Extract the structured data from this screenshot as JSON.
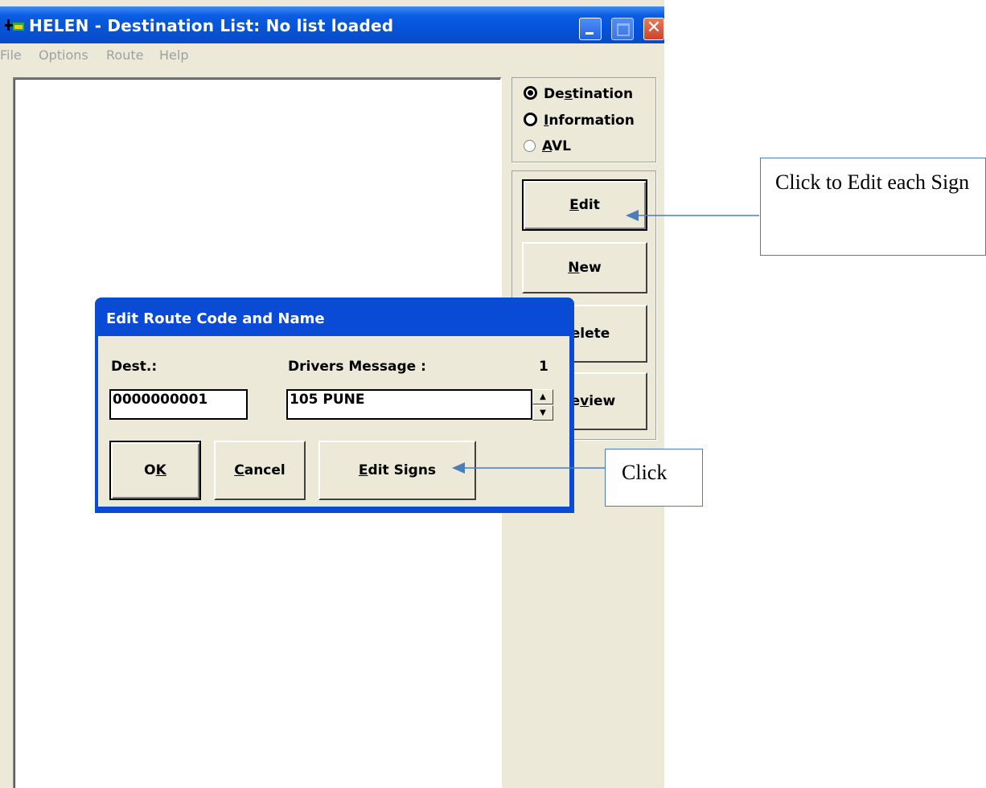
{
  "window": {
    "title": "HELEN - Destination List: No list loaded",
    "close_glyph": "✕"
  },
  "menu": [
    "File",
    "Options",
    "Route",
    "Help"
  ],
  "mode_radios": [
    {
      "label": "Destination",
      "mnemonic": "s",
      "selected": true
    },
    {
      "label": "Information",
      "mnemonic": "I",
      "selected": false
    },
    {
      "label": "AVL",
      "mnemonic": "A",
      "selected": false
    }
  ],
  "side_buttons": {
    "edit": "Edit",
    "new": "New",
    "delete": "Delete",
    "preview": "Preview"
  },
  "dialog": {
    "title": "Edit Route Code and Name",
    "dest_label": "Dest.:",
    "drivers_message_label": "Drivers Message :",
    "message_index": "1",
    "dest_value": "0000000001",
    "drivers_message_value": "105 PUNE",
    "ok_label": "OK",
    "cancel_label": "Cancel",
    "edit_signs_label": "Edit Signs"
  },
  "callouts": {
    "edit_note": "Click to Edit each Sign",
    "click_note": "Click",
    "color": "#4a7ebb"
  }
}
